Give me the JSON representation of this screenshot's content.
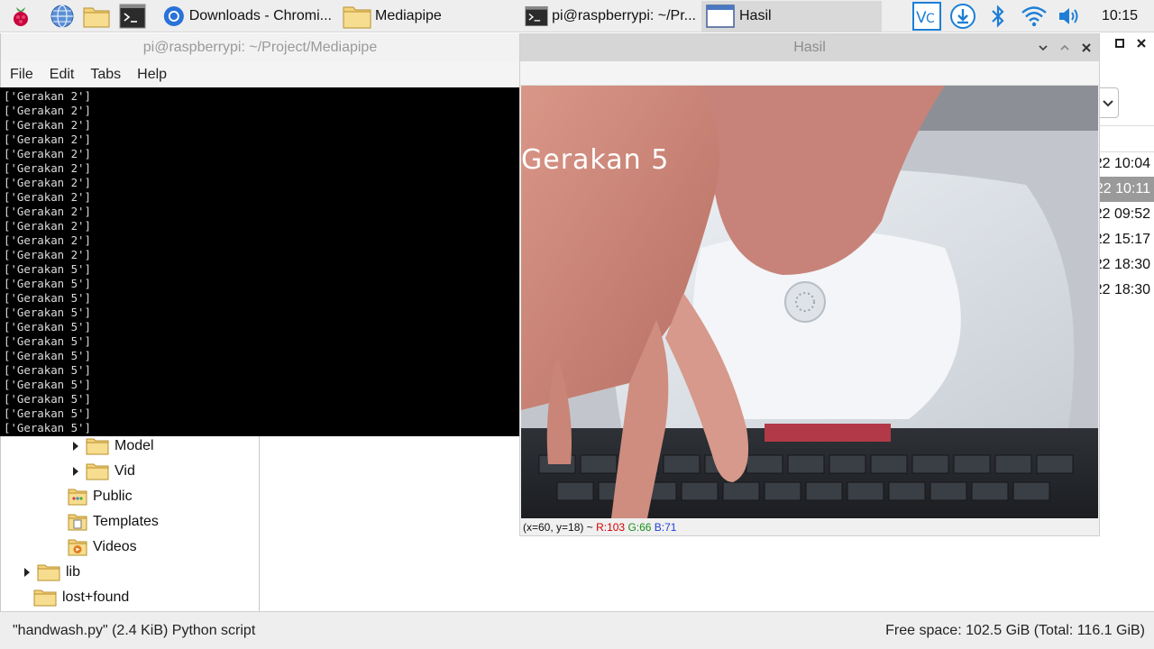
{
  "taskbar": {
    "tasks": [
      {
        "label": "Downloads - Chromi..."
      },
      {
        "label": "Mediapipe"
      },
      {
        "label": "pi@raspberrypi: ~/Pr..."
      },
      {
        "label": "Hasil"
      }
    ],
    "clock": "10:15"
  },
  "terminal": {
    "title": "pi@raspberrypi: ~/Project/Mediapipe",
    "menu": [
      "File",
      "Edit",
      "Tabs",
      "Help"
    ],
    "lines": [
      "['Gerakan 2']",
      "['Gerakan 2']",
      "['Gerakan 2']",
      "['Gerakan 2']",
      "['Gerakan 2']",
      "['Gerakan 2']",
      "['Gerakan 2']",
      "['Gerakan 2']",
      "['Gerakan 2']",
      "['Gerakan 2']",
      "['Gerakan 2']",
      "['Gerakan 2']",
      "['Gerakan 5']",
      "['Gerakan 5']",
      "['Gerakan 5']",
      "['Gerakan 5']",
      "['Gerakan 5']",
      "['Gerakan 5']",
      "['Gerakan 5']",
      "['Gerakan 5']",
      "['Gerakan 5']",
      "['Gerakan 5']",
      "['Gerakan 5']",
      "['Gerakan 5']"
    ]
  },
  "hasil": {
    "title": "Hasil",
    "overlay": "Gerakan 5",
    "status": {
      "coords": "(x=60, y=18) ~",
      "r": "R:103",
      "g": "G:66",
      "b": "B:71"
    }
  },
  "file_manager": {
    "tree": [
      {
        "label": "Model",
        "icon": "folder-icon",
        "expandable": true
      },
      {
        "label": "Vid",
        "icon": "folder-icon",
        "expandable": true
      },
      {
        "label": "Public",
        "icon": "public-folder-icon",
        "expandable": false
      },
      {
        "label": "Templates",
        "icon": "templates-folder-icon",
        "expandable": false
      },
      {
        "label": "Videos",
        "icon": "videos-folder-icon",
        "expandable": false
      },
      {
        "label": "lib",
        "icon": "folder-icon",
        "expandable": true
      },
      {
        "label": "lost+found",
        "icon": "folder-icon",
        "expandable": false
      }
    ],
    "dates": [
      "22 10:04",
      "22 10:11",
      "22 09:52",
      "22 15:17",
      "22 18:30",
      "22 18:30"
    ],
    "status_left": "\"handwash.py\" (2.4 KiB) Python script",
    "status_right": "Free space: 102.5 GiB (Total: 116.1 GiB)"
  }
}
